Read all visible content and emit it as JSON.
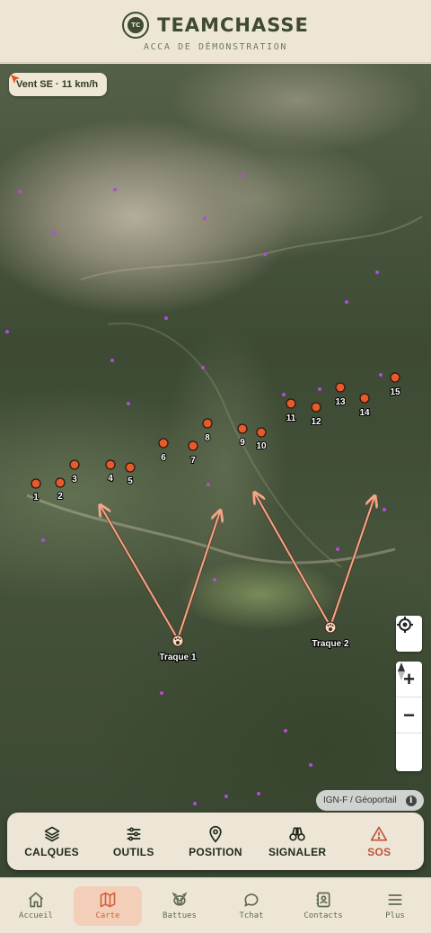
{
  "header": {
    "title": "TEAMCHASSE",
    "subtitle": "ACCA DE DÉMONSTRATION",
    "logo_text": "TC"
  },
  "map": {
    "wind": "Vent SE · 11 km/h",
    "attribution": "IGN-F / Géoportail",
    "info_symbol": "i",
    "zoom_in": "+",
    "zoom_out": "−",
    "posts": [
      {
        "label": "1"
      },
      {
        "label": "2"
      },
      {
        "label": "3"
      },
      {
        "label": "4"
      },
      {
        "label": "5"
      },
      {
        "label": "6"
      },
      {
        "label": "7"
      },
      {
        "label": "8"
      },
      {
        "label": "9"
      },
      {
        "label": "10"
      },
      {
        "label": "11"
      },
      {
        "label": "12"
      },
      {
        "label": "13"
      },
      {
        "label": "14"
      },
      {
        "label": "15"
      }
    ],
    "traques": [
      {
        "label": "Traque 1"
      },
      {
        "label": "Traque 2"
      }
    ],
    "colors": {
      "post": "#e85a2a",
      "arrow": "#f5a588",
      "dots": "#b44bd8"
    }
  },
  "toolbar": {
    "calques": "CALQUES",
    "outils": "OUTILS",
    "position": "POSITION",
    "signaler": "SIGNALER",
    "sos": "SOS"
  },
  "nav": {
    "accueil": "Accueil",
    "carte": "Carte",
    "battues": "Battues",
    "tchat": "Tchat",
    "contacts": "Contacts",
    "plus": "Plus"
  }
}
